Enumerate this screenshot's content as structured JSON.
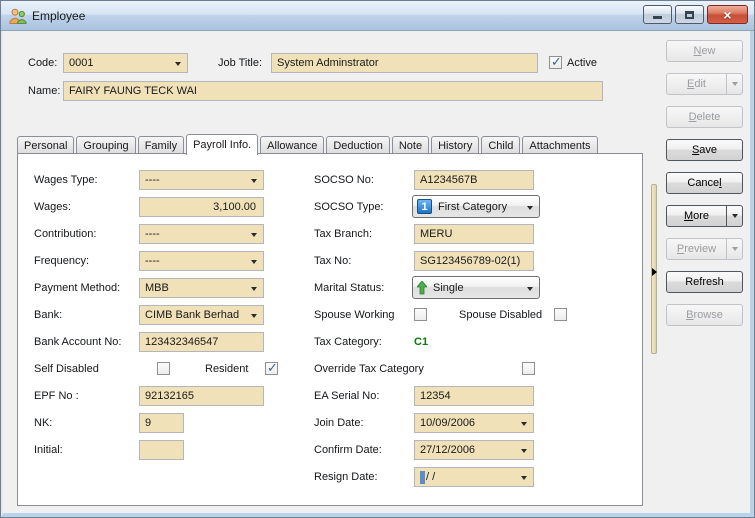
{
  "window": {
    "title": "Employee"
  },
  "titlebar_controls": {
    "close_glyph": "×"
  },
  "header": {
    "code_label": "Code:",
    "code_value": "0001",
    "job_title_label": "Job Title:",
    "job_title_value": "System Adminstrator",
    "active_label": "Active",
    "active_checked": true,
    "name_label": "Name:",
    "name_value": "FAIRY FAUNG TECK WAI"
  },
  "tabs": {
    "active_index": 3,
    "items": [
      "Personal",
      "Grouping",
      "Family",
      "Payroll Info.",
      "Allowance",
      "Deduction",
      "Note",
      "History",
      "Child",
      "Attachments"
    ]
  },
  "payroll": {
    "wages_type": {
      "label": "Wages Type:",
      "value": "----"
    },
    "wages": {
      "label": "Wages:",
      "value": "3,100.00"
    },
    "contribution": {
      "label": "Contribution:",
      "value": "----"
    },
    "frequency": {
      "label": "Frequency:",
      "value": "----"
    },
    "payment_method": {
      "label": "Payment Method:",
      "value": "MBB"
    },
    "bank": {
      "label": "Bank:",
      "value": "CIMB Bank Berhad"
    },
    "bank_account_no": {
      "label": "Bank Account No:",
      "value": "123432346547"
    },
    "self_disabled": {
      "label": "Self Disabled",
      "checked": false
    },
    "resident": {
      "label": "Resident",
      "checked": true
    },
    "epf_no": {
      "label": "EPF No :",
      "value": "92132165"
    },
    "nk": {
      "label": "NK:",
      "value": "9"
    },
    "initial": {
      "label": "Initial:",
      "value": ""
    },
    "socso_no": {
      "label": "SOCSO No:",
      "value": "A1234567B"
    },
    "socso_type": {
      "label": "SOCSO Type:",
      "value": "First Category",
      "icon_text": "1"
    },
    "tax_branch": {
      "label": "Tax Branch:",
      "value": "MERU"
    },
    "tax_no": {
      "label": "Tax No:",
      "value": "SG123456789-02(1)"
    },
    "marital_status": {
      "label": "Marital Status:",
      "value": "Single"
    },
    "spouse_working": {
      "label": "Spouse Working",
      "checked": false
    },
    "spouse_disabled": {
      "label": "Spouse Disabled",
      "checked": false
    },
    "tax_category": {
      "label": "Tax Category:",
      "value": "C1"
    },
    "override_tax_category": {
      "label": "Override Tax Category",
      "checked": false
    },
    "ea_serial_no": {
      "label": "EA Serial No:",
      "value": "12354"
    },
    "join_date": {
      "label": "Join Date:",
      "value": "10/09/2006"
    },
    "confirm_date": {
      "label": "Confirm Date:",
      "value": "27/12/2006"
    },
    "resign_date": {
      "label": "Resign Date:",
      "value": "/ /"
    }
  },
  "action_panel": {
    "buttons": [
      {
        "label": "New",
        "underline": 0,
        "enabled": false,
        "split": false
      },
      {
        "label": "Edit",
        "underline": 0,
        "enabled": false,
        "split": true
      },
      {
        "label": "Delete",
        "underline": 0,
        "enabled": false,
        "split": false
      },
      {
        "label": "Save",
        "underline": 0,
        "enabled": true,
        "split": false
      },
      {
        "label": "Cancel",
        "underline": 5,
        "enabled": true,
        "split": false
      },
      {
        "label": "More",
        "underline": 0,
        "enabled": true,
        "split": true
      },
      {
        "label": "Preview",
        "underline": 0,
        "enabled": false,
        "split": true
      },
      {
        "label": "Refresh",
        "underline": -1,
        "enabled": true,
        "split": false
      },
      {
        "label": "Browse",
        "underline": 0,
        "enabled": false,
        "split": false
      }
    ]
  },
  "colors": {
    "field_bg": "#F1E1B9",
    "field_border": "#B3B6BC",
    "tax_category_green": "#0B7A0B",
    "close_button_red": "#C8503C",
    "socso_icon_blue": "#2D7FD3",
    "marital_arrow_green": "#46A546",
    "splitter_tan": "#E2DAB2"
  }
}
